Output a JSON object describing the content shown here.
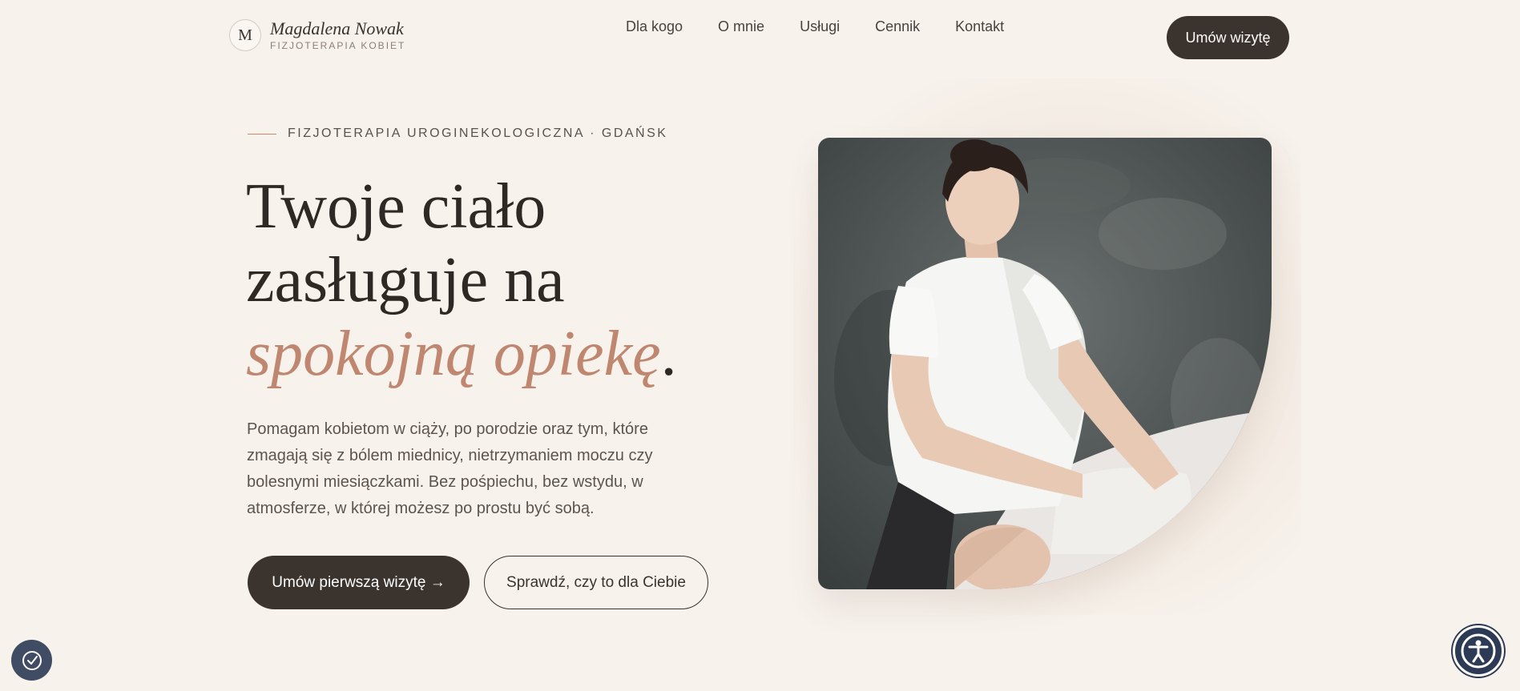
{
  "brand": {
    "mark": "M",
    "name": "Magdalena Nowak",
    "tagline": "FIZJOTERAPIA KOBIET"
  },
  "nav": {
    "items": [
      "Dla kogo",
      "O mnie",
      "Usługi",
      "Cennik",
      "Kontakt"
    ]
  },
  "header": {
    "cta_label": "Umów wizytę"
  },
  "hero": {
    "eyebrow": "FIZJOTERAPIA UROGINEKOLOGICZNA · GDAŃSK",
    "headline_line1": "Twoje ciało",
    "headline_line2": "zasługuje na",
    "headline_accent": "spokojną opiekę",
    "headline_end": ".",
    "lead": "Pomagam kobietom w ciąży, po porodzie oraz tym, które zmagają się z bólem miednicy, nietrzymaniem moczu czy bolesnymi miesiączkami. Bez pośpiechu, bez wstydu, w atmosferze, w której możesz po prostu być sobą.",
    "primary_cta": "Umów pierwszą wizytę →",
    "secondary_cta": "Sprawdź, czy to dla Ciebie"
  },
  "icons": {
    "cookie_settings": "cookie-settings-icon",
    "accessibility": "accessibility-icon"
  },
  "colors": {
    "background": "#f7f2ec",
    "dark": "#3a332e",
    "accent": "#c08770",
    "fab_left": "#3f4c63",
    "fab_right": "#2d3a55"
  }
}
